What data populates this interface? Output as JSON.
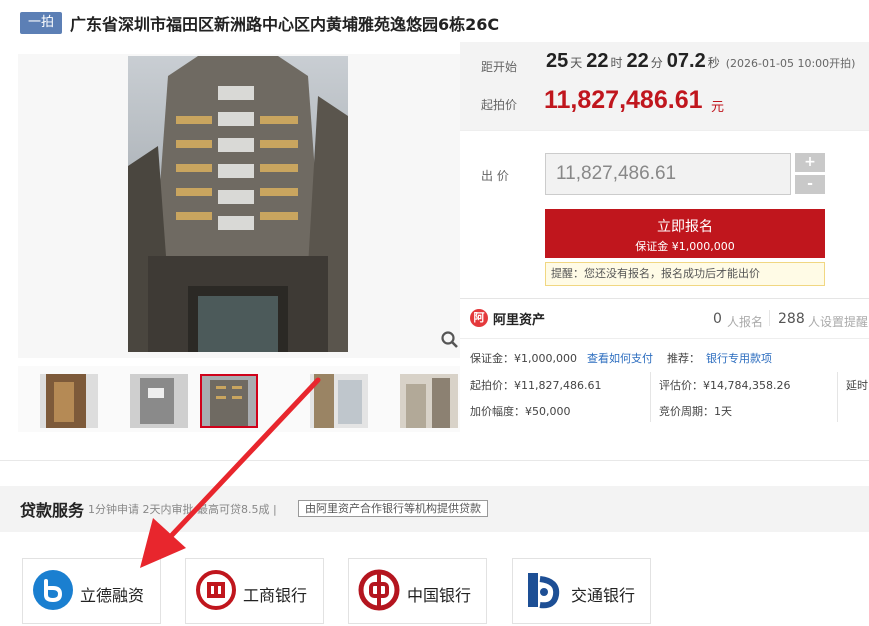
{
  "title": {
    "badge": "一拍",
    "text": "广东省深圳市福田区新洲路中心区内黄埔雅苑逸悠园6栋26C"
  },
  "countdown": {
    "label": "距开始",
    "days": "25",
    "days_unit": "天",
    "hours": "22",
    "hours_unit": "时",
    "minutes": "22",
    "minutes_unit": "分",
    "seconds": "07.2",
    "seconds_unit": "秒",
    "start_note": "(2026-01-05 10:00开拍)"
  },
  "start_price": {
    "label": "起拍价",
    "value": "11,827,486.61",
    "unit": "元"
  },
  "bid": {
    "label": "出 价",
    "input_value": "11,827,486.61",
    "plus": "+",
    "minus": "-"
  },
  "signup": {
    "label": "立即报名",
    "deposit": "保证金 ¥1,000,000"
  },
  "reminder": "提醒：您还没有报名，报名成功后才能出价",
  "platform": {
    "logo_mark": "阿",
    "name": "阿里资产",
    "signup_count": "0",
    "signup_label": "人报名",
    "reminder_count": "288",
    "reminder_label": "人设置提醒"
  },
  "details": {
    "deposit": "保证金：¥1,000,000",
    "how_to_pay": "查看如何支付",
    "recommend_label": "推荐：",
    "bank_account": "银行专用款项",
    "start_price": "起拍价：¥11,827,486.61",
    "valuation": "评估价：¥14,784,358.26",
    "delay": "延时",
    "increment": "加价幅度：¥50,000",
    "cycle": "竞价周期：1天"
  },
  "loan": {
    "title": "贷款服务",
    "desc": "1分钟申请 2天内审批 最高可贷8.5成 |",
    "tag": "由阿里资产合作银行等机构提供贷款",
    "banks": [
      "立德融资",
      "工商银行",
      "中国银行",
      "交通银行"
    ]
  },
  "colors": {
    "accent_red": "#c0161d",
    "badge_blue": "#5c7fb5",
    "link_blue": "#2c6dbf",
    "arrow_red": "#e8262d"
  }
}
